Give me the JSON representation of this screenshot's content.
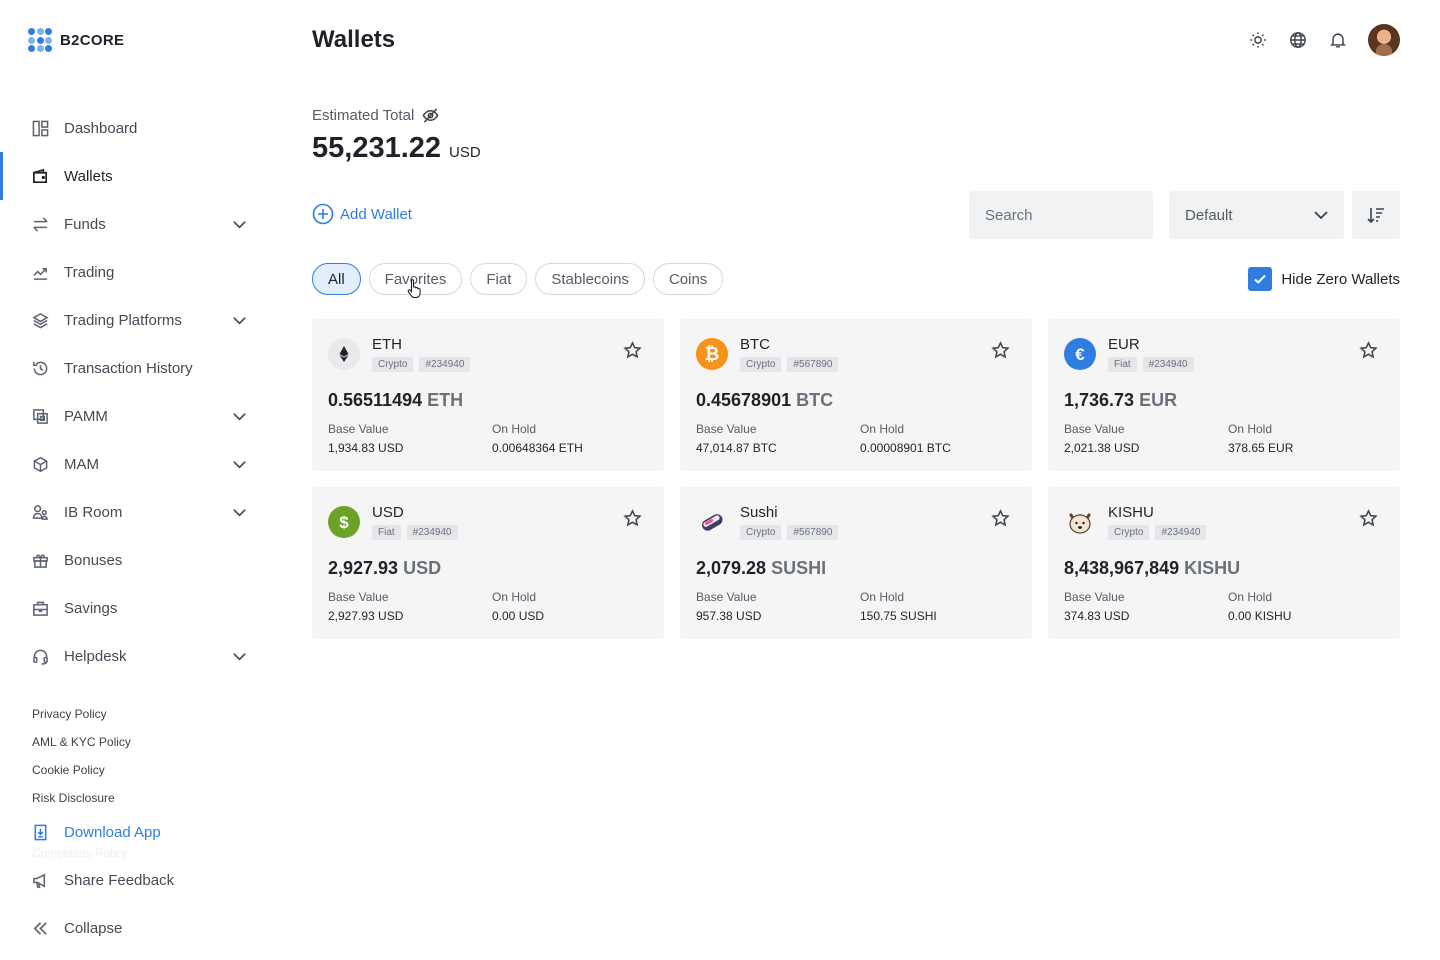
{
  "brand": {
    "name": "B2CORE"
  },
  "sidebar": {
    "items": [
      {
        "label": "Dashboard",
        "icon": "dashboard-icon"
      },
      {
        "label": "Wallets",
        "icon": "wallet-icon"
      },
      {
        "label": "Funds",
        "icon": "transfer-icon"
      },
      {
        "label": "Trading",
        "icon": "chart-line-icon"
      },
      {
        "label": "Trading Platforms",
        "icon": "layers-icon"
      },
      {
        "label": "Transaction History",
        "icon": "history-icon"
      },
      {
        "label": "PAMM",
        "icon": "copy-icon"
      },
      {
        "label": "MAM",
        "icon": "cube-icon"
      },
      {
        "label": "IB Room",
        "icon": "users-icon"
      },
      {
        "label": "Bonuses",
        "icon": "gift-icon"
      },
      {
        "label": "Savings",
        "icon": "briefcase-icon"
      },
      {
        "label": "Helpdesk",
        "icon": "headset-icon"
      }
    ],
    "footer_links": [
      "Privacy Policy",
      "AML & KYC Policy",
      "Cookie Policy",
      "Risk Disclosure"
    ],
    "ghost_link": "Complaints Policy",
    "download_app": "Download App",
    "share_feedback": "Share Feedback",
    "collapse": "Collapse"
  },
  "header": {
    "title": "Wallets"
  },
  "total": {
    "label": "Estimated Total",
    "value": "55,231.22",
    "currency": "USD"
  },
  "toolbar": {
    "add_wallet": "Add Wallet",
    "search_placeholder": "Search",
    "sort_select": "Default"
  },
  "filters": {
    "chips": [
      "All",
      "Favorites",
      "Fiat",
      "Stablecoins",
      "Coins"
    ],
    "active": "All"
  },
  "hide_zero": {
    "label": "Hide Zero Wallets",
    "checked": true
  },
  "colors": {
    "accent": "#2f7de1",
    "btc": "#f7931a",
    "eur": "#2f7de1",
    "usd": "#6aa326"
  },
  "wallets": [
    {
      "name": "ETH",
      "type": "Crypto",
      "id": "#234940",
      "amount": "0.56511494",
      "symbol": "ETH",
      "base_label": "Base Value",
      "base_value": "1,934.83 USD",
      "hold_label": "On Hold",
      "hold_value": "0.00648364 ETH",
      "icon": "ethereum-icon"
    },
    {
      "name": "BTC",
      "type": "Crypto",
      "id": "#567890",
      "amount": "0.45678901",
      "symbol": "BTC",
      "base_label": "Base Value",
      "base_value": "47,014.87 BTC",
      "hold_label": "On Hold",
      "hold_value": "0.00008901 BTC",
      "icon": "bitcoin-icon"
    },
    {
      "name": "EUR",
      "type": "Fiat",
      "id": "#234940",
      "amount": "1,736.73",
      "symbol": "EUR",
      "base_label": "Base Value",
      "base_value": "2,021.38 USD",
      "hold_label": "On Hold",
      "hold_value": "378.65 EUR",
      "icon": "euro-icon"
    },
    {
      "name": "USD",
      "type": "Fiat",
      "id": "#234940",
      "amount": "2,927.93",
      "symbol": "USD",
      "base_label": "Base Value",
      "base_value": "2,927.93 USD",
      "hold_label": "On Hold",
      "hold_value": "0.00 USD",
      "icon": "dollar-icon"
    },
    {
      "name": "Sushi",
      "type": "Crypto",
      "id": "#567890",
      "amount": "2,079.28",
      "symbol": "SUSHI",
      "base_label": "Base Value",
      "base_value": "957.38 USD",
      "hold_label": "On Hold",
      "hold_value": "150.75 SUSHI",
      "icon": "sushi-icon"
    },
    {
      "name": "KISHU",
      "type": "Crypto",
      "id": "#234940",
      "amount": "8,438,967,849",
      "symbol": "KISHU",
      "base_label": "Base Value",
      "base_value": "374.83 USD",
      "hold_label": "On Hold",
      "hold_value": "0.00 KISHU",
      "icon": "kishu-dog-icon"
    }
  ]
}
